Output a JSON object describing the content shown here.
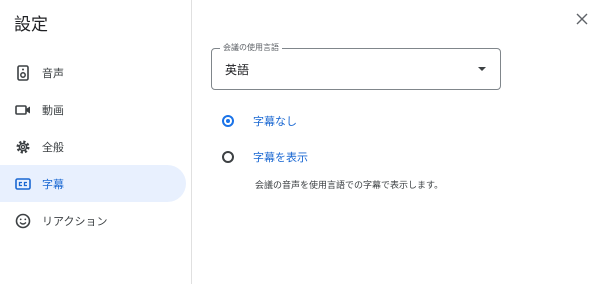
{
  "dialog": {
    "title": "設定"
  },
  "sidebar": {
    "items": [
      {
        "label": "音声",
        "icon": "speaker-icon",
        "active": false
      },
      {
        "label": "動画",
        "icon": "video-camera-icon",
        "active": false
      },
      {
        "label": "全般",
        "icon": "gear-icon",
        "active": false
      },
      {
        "label": "字幕",
        "icon": "closed-caption-icon",
        "active": true
      },
      {
        "label": "リアクション",
        "icon": "smiley-icon",
        "active": false
      }
    ]
  },
  "captions": {
    "language_field": {
      "label": "会議の使用言語",
      "value": "英語"
    },
    "options": [
      {
        "label": "字幕なし",
        "checked": true
      },
      {
        "label": "字幕を表示",
        "checked": false
      }
    ],
    "show_description": "会議の音声を使用言語での字幕で表示します。"
  },
  "colors": {
    "accent": "#1a73e8",
    "active_bg": "#e8f0fe",
    "text": "#3c4043"
  }
}
